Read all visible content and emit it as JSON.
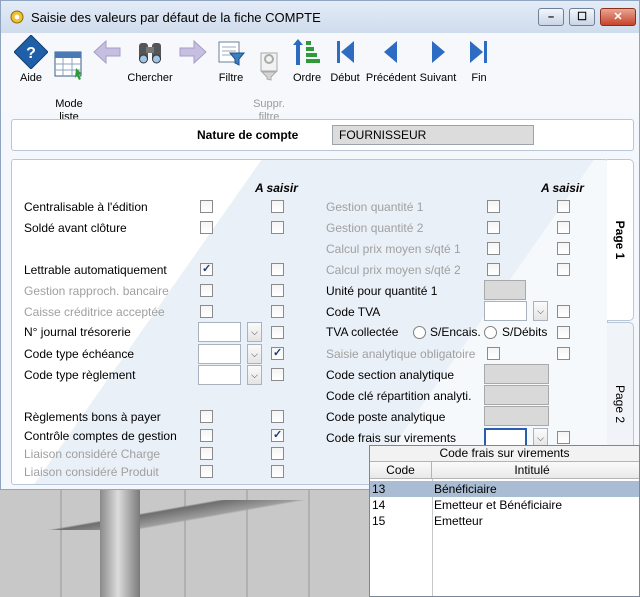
{
  "window": {
    "title": "Saisie des valeurs par défaut de la fiche COMPTE",
    "controls": {
      "minimize": "–",
      "maximize": "☐",
      "close": "✕"
    }
  },
  "toolbar": [
    {
      "id": "aide",
      "label": "Aide",
      "icon": "help-icon",
      "enabled": true
    },
    {
      "id": "mode-liste",
      "label": "Mode\nliste",
      "icon": "grid-list-icon",
      "enabled": true
    },
    {
      "id": "precedent-fleche",
      "label": "",
      "icon": "arrow-left-icon",
      "enabled": false
    },
    {
      "id": "chercher",
      "label": "Chercher",
      "icon": "binoculars-icon",
      "enabled": true
    },
    {
      "id": "suivant-fleche",
      "label": "",
      "icon": "arrow-right-icon",
      "enabled": false
    },
    {
      "id": "filtre",
      "label": "Filtre",
      "icon": "filter-icon",
      "enabled": true
    },
    {
      "id": "suppr-filtre",
      "label": "Suppr.\nfiltre",
      "icon": "remove-filter-icon",
      "enabled": false
    },
    {
      "id": "ordre",
      "label": "Ordre",
      "icon": "sort-icon",
      "enabled": true
    },
    {
      "id": "debut",
      "label": "Début",
      "icon": "first-record-icon",
      "enabled": true
    },
    {
      "id": "precedent",
      "label": "Précédent",
      "icon": "previous-record-icon",
      "enabled": true
    },
    {
      "id": "suivant",
      "label": "Suivant",
      "icon": "next-record-icon",
      "enabled": true
    },
    {
      "id": "fin",
      "label": "Fin",
      "icon": "last-record-icon",
      "enabled": true
    }
  ],
  "nature": {
    "label": "Nature de compte",
    "value": "FOURNISSEUR"
  },
  "headers": {
    "left": "A saisir",
    "right": "A saisir"
  },
  "left_fields": [
    {
      "label": "Centralisable à l'édition",
      "enabled": true,
      "value_checked": false,
      "saisir_checked": false
    },
    {
      "label": "Soldé avant clôture",
      "enabled": true,
      "value_checked": false,
      "saisir_checked": false
    },
    {
      "label": "Lettrable automatiquement",
      "enabled": true,
      "value_checked": true,
      "saisir_checked": false
    },
    {
      "label": "Gestion rapproch. bancaire",
      "enabled": false,
      "value_checked": false,
      "saisir_checked": false
    },
    {
      "label": "Caisse créditrice acceptée",
      "enabled": false,
      "value_checked": false,
      "saisir_checked": false
    },
    {
      "label": "N° journal trésorerie",
      "enabled": true,
      "saisir_checked": false
    },
    {
      "label": "Code type échéance",
      "enabled": true,
      "saisir_checked": true
    },
    {
      "label": "Code type règlement",
      "enabled": true,
      "saisir_checked": false
    },
    {
      "label": "Règlements bons à payer",
      "enabled": true,
      "value_checked": false,
      "saisir_checked": false
    },
    {
      "label": "Contrôle comptes de gestion",
      "enabled": true,
      "value_checked": false,
      "saisir_checked": true
    },
    {
      "label": "Liaison considéré Charge",
      "enabled": false,
      "value_checked": false,
      "saisir_checked": false
    },
    {
      "label": "Liaison considéré Produit",
      "enabled": false,
      "value_checked": false,
      "saisir_checked": false
    }
  ],
  "right_fields": [
    {
      "label": "Gestion quantité 1",
      "enabled": false,
      "value_checked": false,
      "saisir_checked": false
    },
    {
      "label": "Gestion quantité 2",
      "enabled": false,
      "value_checked": false,
      "saisir_checked": false
    },
    {
      "label": "Calcul prix moyen s/qté 1",
      "enabled": false,
      "value_checked": false,
      "saisir_checked": false
    },
    {
      "label": "Calcul prix moyen s/qté 2",
      "enabled": false,
      "value_checked": false,
      "saisir_checked": false
    },
    {
      "label": "Unité pour quantité 1",
      "enabled": true
    },
    {
      "label": "Code TVA",
      "enabled": true,
      "saisir_checked": false
    },
    {
      "label": "TVA collectée",
      "enabled": true,
      "saisir_checked": false,
      "radio1": "S/Encais.",
      "radio2": "S/Débits"
    },
    {
      "label": "Saisie analytique obligatoire",
      "enabled": false,
      "value_checked": false,
      "saisir_checked": false
    },
    {
      "label": "Code section analytique",
      "enabled": true
    },
    {
      "label": "Code clé répartition analyti.",
      "enabled": true
    },
    {
      "label": "Code poste analytique",
      "enabled": true
    },
    {
      "label": "Code frais sur virements",
      "enabled": true,
      "saisir_checked": false
    }
  ],
  "tabs": [
    {
      "label": "Page 1",
      "active": true
    },
    {
      "label": "Page 2",
      "active": false
    }
  ],
  "popup": {
    "title": "Code frais sur virements",
    "columns": [
      "Code",
      "Intitulé"
    ],
    "rows": [
      {
        "code": "13",
        "label": "Bénéficiaire",
        "selected": true
      },
      {
        "code": "14",
        "label": "Emetteur et Bénéficiaire",
        "selected": false
      },
      {
        "code": "15",
        "label": "Emetteur",
        "selected": false
      }
    ]
  }
}
